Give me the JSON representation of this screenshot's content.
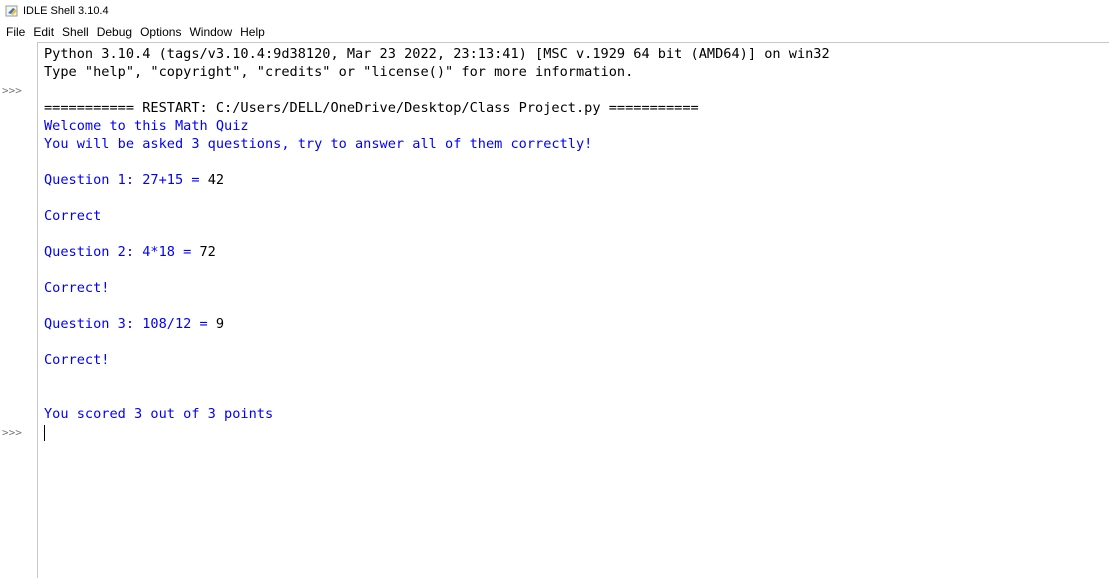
{
  "window": {
    "title": "IDLE Shell 3.10.4",
    "icon": "python-feather-icon"
  },
  "menu": [
    "File",
    "Edit",
    "Shell",
    "Debug",
    "Options",
    "Window",
    "Help"
  ],
  "prompts": [
    ">>>",
    ">>>"
  ],
  "shell": {
    "banner1": "Python 3.10.4 (tags/v3.10.4:9d38120, Mar 23 2022, 23:13:41) [MSC v.1929 64 bit (AMD64)] on win32",
    "banner2": "Type \"help\", \"copyright\", \"credits\" or \"license()\" for more information.",
    "restart": "=========== RESTART: C:/Users/DELL/OneDrive/Desktop/Class Project.py ===========",
    "welcome": "Welcome to this Math Quiz",
    "instructions": "You will be asked 3 questions, try to answer all of them correctly!",
    "q1_prompt": "Question 1: 27+15 = ",
    "q1_answer": "42",
    "r1": "Correct",
    "q2_prompt": "Question 2: 4*18 = ",
    "q2_answer": "72",
    "r2": "Correct!",
    "q3_prompt": "Question 3: 108/12 = ",
    "q3_answer": "9",
    "r3": "Correct!",
    "score": "You scored 3 out of 3 points"
  },
  "colors": {
    "stdout": "#0000ff",
    "stdin": "#000000",
    "prompt": "#7a7a7a"
  }
}
